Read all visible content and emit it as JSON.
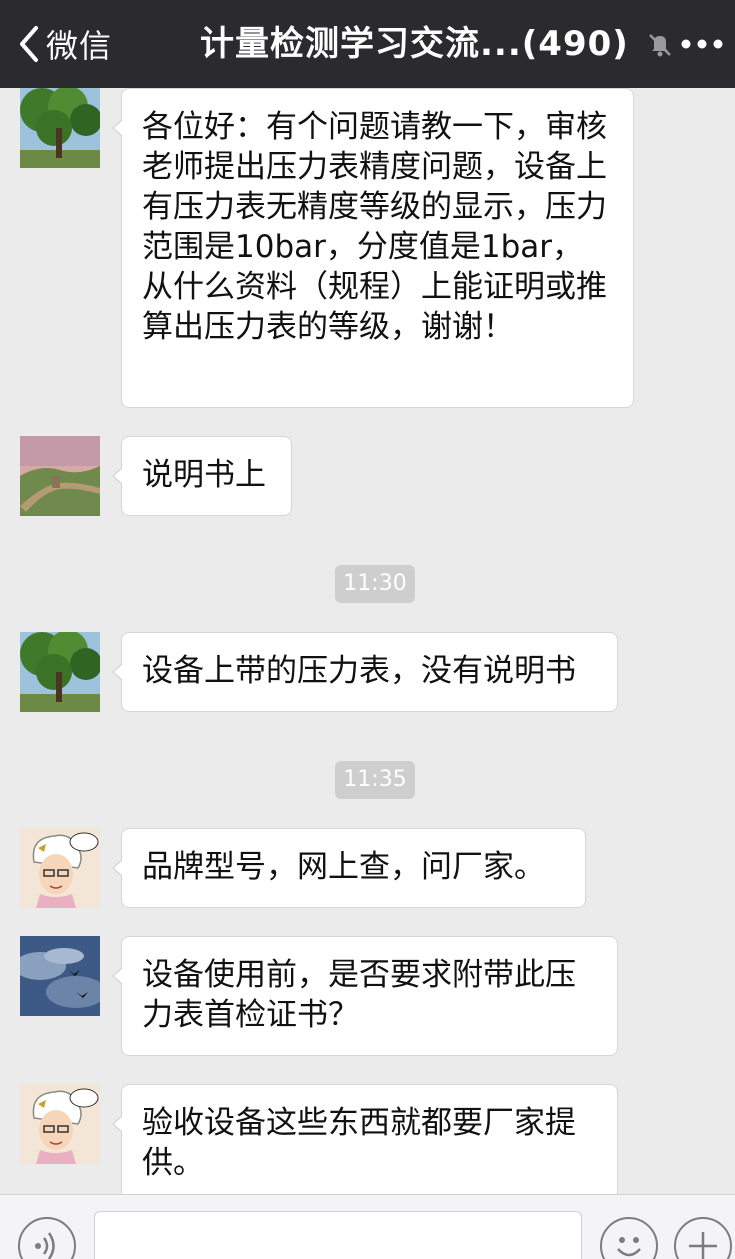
{
  "header": {
    "back_label": "微信",
    "title": "计量检测学习交流...(490)",
    "back_icon": "chevron-left-icon",
    "mute_icon": "bell-off-icon",
    "more_icon": "more-dots-icon",
    "background": "#2b2b2f"
  },
  "messages": [
    {
      "avatar": "tree-avatar",
      "text": "各位好：有个问题请教一下，审核老师提出压力表精度问题，设备上有压力表无精度等级的显示，压力范围是10bar，分度值是1bar，从什么资料（规程）上能证明或推算出压力表的等级，谢谢！"
    },
    {
      "avatar": "great-wall-avatar",
      "text": "说明书上"
    },
    {
      "avatar": "tree-avatar",
      "text": "设备上带的压力表，没有说明书"
    },
    {
      "avatar": "cartoon-avatar",
      "text": "品牌型号，网上查，问厂家。"
    },
    {
      "avatar": "sky-birds-avatar",
      "text": "设备使用前，是否要求附带此压力表首检证书？"
    },
    {
      "avatar": "cartoon-avatar",
      "text": "验收设备这些东西就都要厂家提供。"
    }
  ],
  "timestamps": [
    "11:30",
    "11:35"
  ],
  "input_bar": {
    "voice_icon": "voice-icon",
    "emoji_icon": "emoji-icon",
    "plus_icon": "plus-icon",
    "text_value": ""
  }
}
